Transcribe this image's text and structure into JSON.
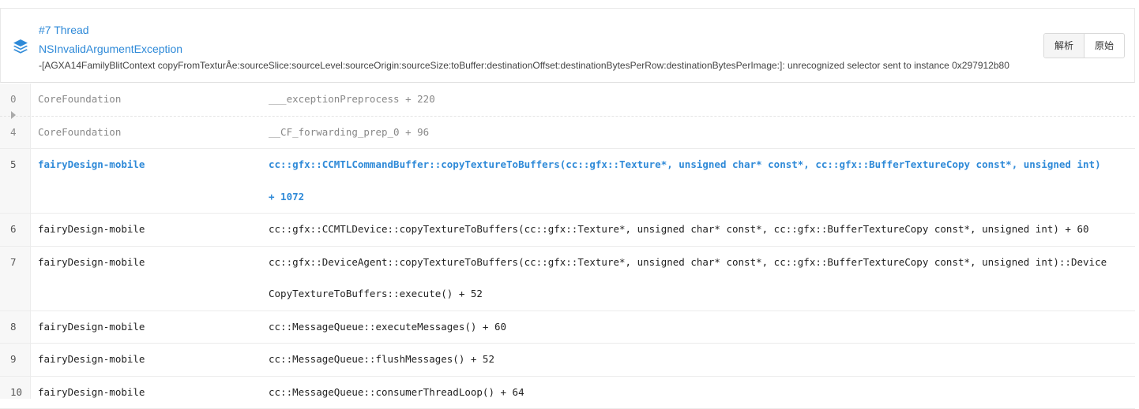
{
  "header": {
    "thread_title": "#7 Thread",
    "exception_name": "NSInvalidArgumentException",
    "exception_reason": "-[AGXA14FamilyBlitContext copyFromTexturÂe:sourceSlice:sourceLevel:sourceOrigin:sourceSize:toBuffer:destinationOffset:destinationBytesPerRow:destinationBytesPerImage:]: unrecognized selector sent to instance 0x297912b80",
    "icon": "stack-layers-icon",
    "buttons": {
      "parsed": "解析",
      "raw": "原始"
    }
  },
  "frames": [
    {
      "index": "0",
      "library": "CoreFoundation",
      "symbol": "___exceptionPreprocess + 220",
      "style": "system"
    },
    {
      "index": "4",
      "library": "CoreFoundation",
      "symbol": "__CF_forwarding_prep_0 + 96",
      "style": "system"
    },
    {
      "index": "5",
      "library": "fairyDesign-mobile",
      "symbol": "cc::gfx::CCMTLCommandBuffer::copyTextureToBuffers(cc::gfx::Texture*, unsigned char* const*, cc::gfx::BufferTextureCopy const*, unsigned int) + 1072",
      "style": "highlight"
    },
    {
      "index": "6",
      "library": "fairyDesign-mobile",
      "symbol": "cc::gfx::CCMTLDevice::copyTextureToBuffers(cc::gfx::Texture*, unsigned char* const*, cc::gfx::BufferTextureCopy const*, unsigned int) + 60",
      "style": "normal"
    },
    {
      "index": "7",
      "library": "fairyDesign-mobile",
      "symbol": "cc::gfx::DeviceAgent::copyTextureToBuffers(cc::gfx::Texture*, unsigned char* const*, cc::gfx::BufferTextureCopy const*, unsigned int)::DeviceCopyTextureToBuffers::execute() + 52",
      "style": "normal"
    },
    {
      "index": "8",
      "library": "fairyDesign-mobile",
      "symbol": "cc::MessageQueue::executeMessages() + 60",
      "style": "normal"
    },
    {
      "index": "9",
      "library": "fairyDesign-mobile",
      "symbol": "cc::MessageQueue::flushMessages() + 52",
      "style": "normal"
    },
    {
      "index": "10",
      "library": "fairyDesign-mobile",
      "symbol": "cc::MessageQueue::consumerThreadLoop() + 64",
      "style": "normal"
    }
  ],
  "collapsed_toggle_icon": "caret-right-icon",
  "colors": {
    "accent": "#2f8ad8",
    "system_text": "#888888",
    "gutter": "#f7f7f7"
  }
}
